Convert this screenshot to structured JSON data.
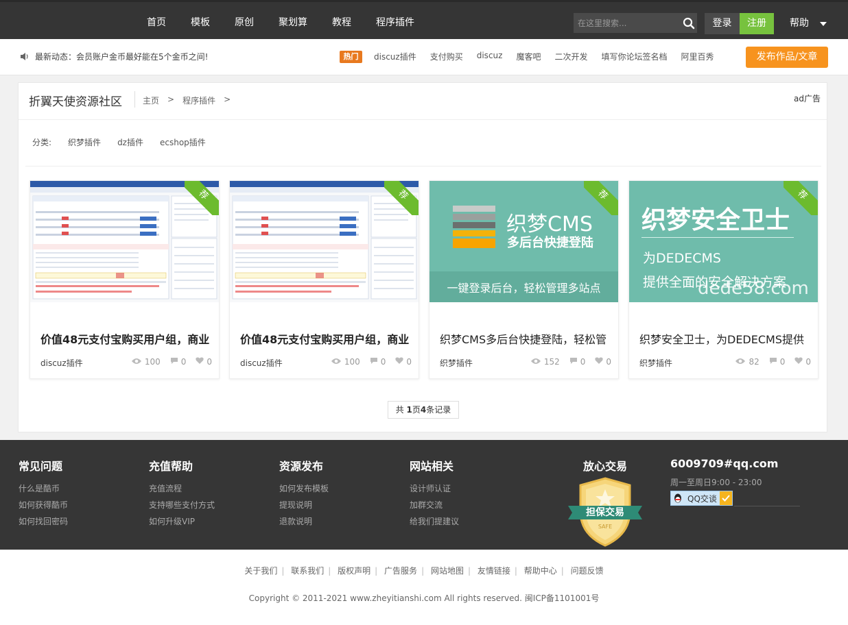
{
  "nav": {
    "items": [
      "首页",
      "模板",
      "原创",
      "聚划算",
      "教程",
      "程序插件"
    ]
  },
  "search": {
    "placeholder": "在这里搜索..."
  },
  "auth": {
    "login": "登录",
    "register": "注册",
    "help": "帮助"
  },
  "news": {
    "label": "最新动态：会员账户金币最好能在5个金币之间!",
    "hot": "热门",
    "links": [
      "discuz插件",
      "支付购买",
      "discuz",
      "魔客吧",
      "二次开发",
      "填写你论坛签名档",
      "阿里百秀"
    ],
    "publish": "发布作品/文章"
  },
  "header": {
    "site_name": "折翼天使资源社区",
    "crumbs": [
      "主页",
      ">",
      "程序插件",
      ">"
    ],
    "ad": "ad广告"
  },
  "categories": {
    "label": "分类:",
    "items": [
      "织梦插件",
      "dz插件",
      "ecshop插件"
    ]
  },
  "cards": [
    {
      "title": "价值48元支付宝购买用户组，商业",
      "category": "discuz插件",
      "views": "100",
      "comments": "0",
      "likes": "0",
      "ribbon": "荐"
    },
    {
      "title": "价值48元支付宝购买用户组，商业",
      "category": "discuz插件",
      "views": "100",
      "comments": "0",
      "likes": "0",
      "ribbon": "荐"
    },
    {
      "title": "织梦CMS多后台快捷登陆，轻松管",
      "category": "织梦插件",
      "views": "152",
      "comments": "0",
      "likes": "0",
      "ribbon": "荐",
      "thumb_title": "织梦CMS",
      "thumb_sub": "多后台快捷登陆",
      "thumb_caption": "一键登录后台，轻松管理多站点"
    },
    {
      "title": "织梦安全卫士，为DEDECMS提供",
      "category": "织梦插件",
      "views": "82",
      "comments": "0",
      "likes": "0",
      "ribbon": "荐",
      "thumb_title": "织梦安全卫士",
      "thumb_sub": "为DEDECMS",
      "thumb_caption": "提供全面的安全解决方案",
      "thumb_watermark": "dede58.com"
    }
  ],
  "pager": {
    "pre": "共 ",
    "pages": "1",
    "mid": "页",
    "records": "4",
    "post": "条记录"
  },
  "footer": {
    "cols": [
      {
        "title": "常见问题",
        "links": [
          "什么是酷币",
          "如何获得酷币",
          "如何找回密码"
        ]
      },
      {
        "title": "充值帮助",
        "links": [
          "充值流程",
          "支持哪些支付方式",
          "如何升级VIP"
        ]
      },
      {
        "title": "资源发布",
        "links": [
          "如何发布模板",
          "提现说明",
          "退款说明"
        ]
      },
      {
        "title": "网站相关",
        "links": [
          "设计师认证",
          "加群交流",
          "给我们提建议"
        ]
      }
    ],
    "trade_title": "放心交易",
    "badge_text": "担保交易",
    "badge_small": "SAFE",
    "email": "6009709#qq.com",
    "hours": "周一至周日9:00 - 23:00",
    "qq_label": "QQ交谈"
  },
  "bottom": {
    "links": [
      "关于我们",
      "联系我们",
      "版权声明",
      "广告服务",
      "网站地图",
      "友情链接",
      "帮助中心",
      "问题反馈"
    ],
    "copyright": "Copyright © 2011-2021 www.zheyitianshi.com All rights reserved. 闽ICP备1101001号"
  },
  "colors": {
    "topbar": "#353535",
    "green": "#77c23e",
    "orange": "#f7931e",
    "teal": "#6fbcab"
  }
}
